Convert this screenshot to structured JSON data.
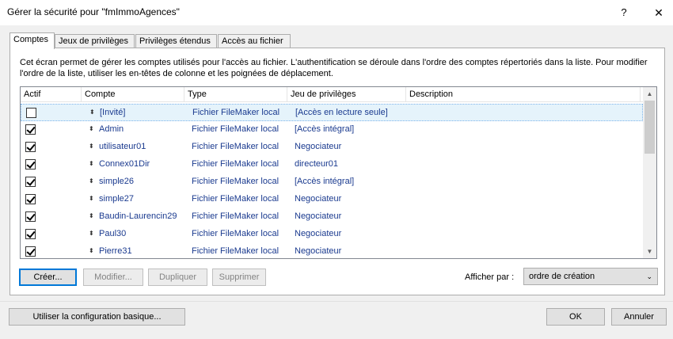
{
  "window": {
    "title": "Gérer la sécurité pour \"fmImmoAgences\"",
    "help": "?",
    "close": "✕"
  },
  "tabs": [
    {
      "label": "Comptes"
    },
    {
      "label": "Jeux de privilèges"
    },
    {
      "label": "Privilèges étendus"
    },
    {
      "label": "Accès au fichier"
    }
  ],
  "description": "Cet écran permet de gérer les comptes utilisés pour l'accès au fichier. L'authentification se déroule dans l'ordre des comptes répertoriés dans la liste. Pour modifier l'ordre de la liste, utiliser les en-têtes de colonne et les poignées de déplacement.",
  "columns": [
    "Actif",
    "Compte",
    "Type",
    "Jeu de privilèges",
    "Description"
  ],
  "accounts": [
    {
      "active": false,
      "name": "[Invité]",
      "type": "Fichier FileMaker local",
      "privilege": "[Accès en lecture seule]",
      "description": ""
    },
    {
      "active": true,
      "name": "Admin",
      "type": "Fichier FileMaker local",
      "privilege": "[Accès intégral]",
      "description": ""
    },
    {
      "active": true,
      "name": "utilisateur01",
      "type": "Fichier FileMaker local",
      "privilege": "Negociateur",
      "description": ""
    },
    {
      "active": true,
      "name": "Connex01Dir",
      "type": "Fichier FileMaker local",
      "privilege": "directeur01",
      "description": ""
    },
    {
      "active": true,
      "name": "simple26",
      "type": "Fichier FileMaker local",
      "privilege": "[Accès intégral]",
      "description": ""
    },
    {
      "active": true,
      "name": "simple27",
      "type": "Fichier FileMaker local",
      "privilege": "Negociateur",
      "description": ""
    },
    {
      "active": true,
      "name": "Baudin-Laurencin29",
      "type": "Fichier FileMaker local",
      "privilege": "Negociateur",
      "description": ""
    },
    {
      "active": true,
      "name": "Paul30",
      "type": "Fichier FileMaker local",
      "privilege": "Negociateur",
      "description": ""
    },
    {
      "active": true,
      "name": "Pierre31",
      "type": "Fichier FileMaker local",
      "privilege": "Negociateur",
      "description": ""
    }
  ],
  "buttons": {
    "create": "Créer...",
    "modify": "Modifier...",
    "duplicate": "Dupliquer",
    "delete": "Supprimer",
    "basic_config": "Utiliser la configuration basique...",
    "ok": "OK",
    "cancel": "Annuler"
  },
  "view": {
    "label": "Afficher par :",
    "selected": "ordre de création"
  },
  "icons": {
    "drag_handle": "⬍",
    "scroll_up": "▲",
    "scroll_down": "▼",
    "dropdown": "⌄"
  }
}
